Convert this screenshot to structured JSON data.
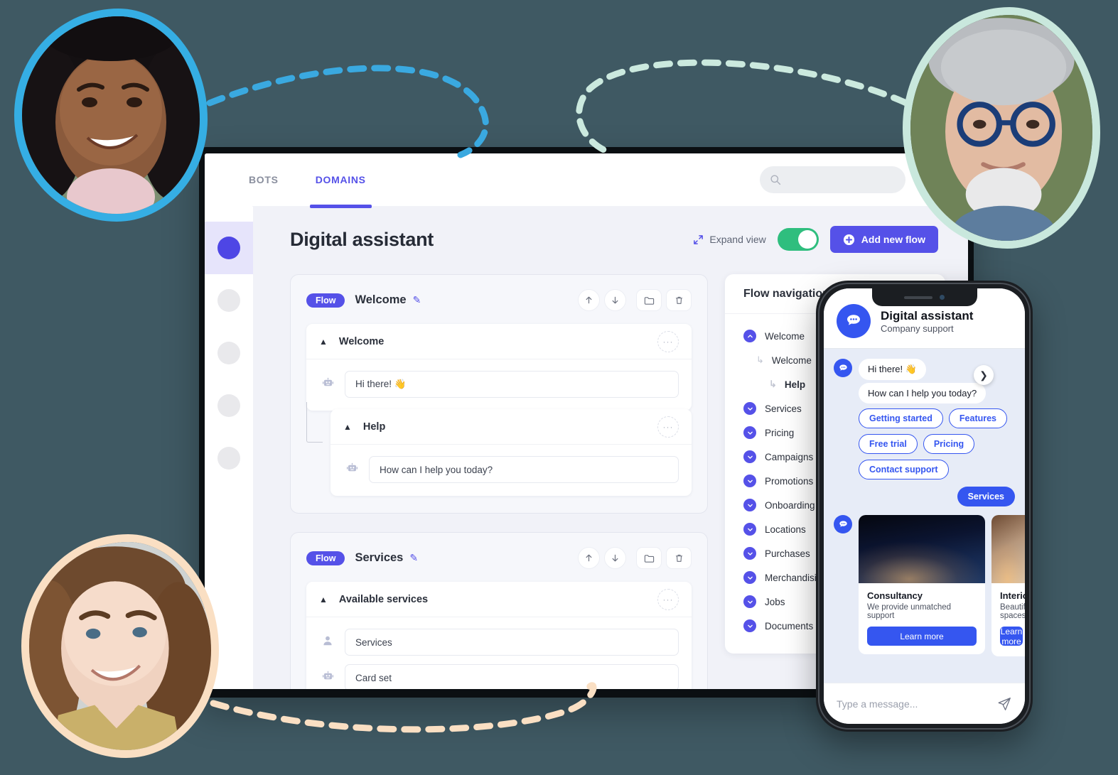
{
  "nav": {
    "tabs": [
      {
        "label": "BOTS",
        "active": false
      },
      {
        "label": "DOMAINS",
        "active": true
      }
    ],
    "search_placeholder": "",
    "search_icon": "search-icon"
  },
  "page": {
    "title": "Digital assistant",
    "expand_view_label": "Expand view",
    "expand_view_on": true,
    "add_flow_label": "Add new flow"
  },
  "flows": [
    {
      "badge": "Flow",
      "name": "Welcome",
      "nodes": [
        {
          "title": "Welcome",
          "rows": [
            {
              "icon": "bot-icon",
              "value": "Hi there! 👋"
            }
          ]
        }
      ],
      "child": {
        "title": "Help",
        "rows": [
          {
            "icon": "bot-icon",
            "value": "How can I help you today?"
          }
        ]
      }
    },
    {
      "badge": "Flow",
      "name": "Services",
      "nodes": [
        {
          "title": "Available services",
          "rows": [
            {
              "icon": "user-icon",
              "value": "Services"
            },
            {
              "icon": "bot-icon",
              "value": "Card set"
            }
          ]
        }
      ]
    }
  ],
  "flow_navigation": {
    "title": "Flow navigation",
    "items": [
      {
        "label": "Welcome",
        "level": 0,
        "state": "expanded"
      },
      {
        "label": "Welcome",
        "level": 1,
        "state": "child"
      },
      {
        "label": "Help",
        "level": 2,
        "state": "child"
      },
      {
        "label": "Services",
        "level": 0,
        "state": "collapsed"
      },
      {
        "label": "Pricing",
        "level": 0,
        "state": "collapsed"
      },
      {
        "label": "Campaigns",
        "level": 0,
        "state": "collapsed"
      },
      {
        "label": "Promotions",
        "level": 0,
        "state": "collapsed"
      },
      {
        "label": "Onboarding",
        "level": 0,
        "state": "collapsed"
      },
      {
        "label": "Locations",
        "level": 0,
        "state": "collapsed"
      },
      {
        "label": "Purchases",
        "level": 0,
        "state": "collapsed"
      },
      {
        "label": "Merchandising",
        "level": 0,
        "state": "collapsed"
      },
      {
        "label": "Jobs",
        "level": 0,
        "state": "collapsed"
      },
      {
        "label": "Documents",
        "level": 0,
        "state": "collapsed"
      }
    ]
  },
  "phone": {
    "header": {
      "title": "Digital assistant",
      "subtitle": "Company support",
      "logo_icon": "chat-bubble-icon"
    },
    "messages": [
      {
        "from": "bot",
        "text": "Hi there! 👋"
      },
      {
        "from": "bot",
        "text": "How can I help you today?"
      }
    ],
    "quick_replies": [
      "Getting started",
      "Features",
      "Free trial",
      "Pricing",
      "Contact support"
    ],
    "user_reply": "Services",
    "carousel": [
      {
        "title": "Consultancy",
        "subtitle": "We provide unmatched support",
        "button": "Learn more"
      },
      {
        "title": "Interiors",
        "subtitle": "Beautiful spaces",
        "button": "Learn more"
      }
    ],
    "next_icon": "chevron-right-icon",
    "input_placeholder": "Type a message...",
    "send_icon": "send-icon"
  },
  "sidebar": {
    "items": [
      {
        "name": "sidebar-dot-1",
        "active": true
      },
      {
        "name": "sidebar-dot-2",
        "active": false
      },
      {
        "name": "sidebar-dot-3",
        "active": false
      },
      {
        "name": "sidebar-dot-4",
        "active": false
      },
      {
        "name": "sidebar-dot-5",
        "active": false
      }
    ]
  },
  "colors": {
    "accent": "#5551e8",
    "phone_accent": "#3556f0",
    "toggle_on": "#2fbe7e",
    "app_bg": "#f1f2f8",
    "page_bg": "#3f5963",
    "ring_blue": "#35aee4",
    "ring_mint": "#c9e8dd",
    "ring_peach": "#fadfc3"
  }
}
